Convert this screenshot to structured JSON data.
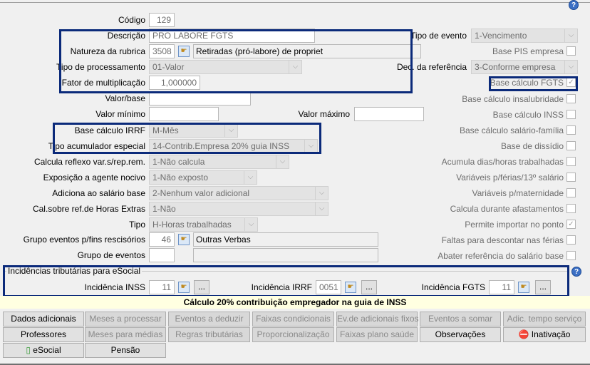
{
  "help_icon": "?",
  "left": {
    "codigo": {
      "label": "Código",
      "value": "129"
    },
    "descricao": {
      "label": "Descrição",
      "value": "PRO LABORE FGTS"
    },
    "natureza": {
      "label": "Natureza da rubrica",
      "code": "3508",
      "description": "Retiradas (pró-labore) de propriet"
    },
    "tipo_processamento": {
      "label": "Tipo de processamento",
      "value": "01-Valor"
    },
    "fator": {
      "label": "Fator de multiplicação",
      "value": "1,000000"
    },
    "valor_base": {
      "label": "Valor/base",
      "value": ""
    },
    "valor_minimo": {
      "label": "Valor mínimo",
      "value": ""
    },
    "valor_maximo": {
      "label": "Valor máximo",
      "value": ""
    },
    "base_irrf": {
      "label": "Base cálculo IRRF",
      "value": "M-Mês"
    },
    "tipo_acumulador": {
      "label": "Tipo acumulador especial",
      "value": "14-Contrib.Empresa 20% guia INSS"
    },
    "calcula_reflexo": {
      "label": "Calcula reflexo var.s/rep.rem.",
      "value": "1-Não calcula"
    },
    "exposicao": {
      "label": "Exposição a agente nocivo",
      "value": "1-Não exposto"
    },
    "adiciona": {
      "label": "Adiciona ao salário base",
      "value": "2-Nenhum valor adicional"
    },
    "cal_sobre": {
      "label": "Cal.sobre ref.de Horas Extras",
      "value": "1-Não"
    },
    "tipo": {
      "label": "Tipo",
      "value": "H-Horas trabalhadas"
    },
    "grupo_rescisorios": {
      "label": "Grupo eventos p/fins rescisórios",
      "code": "46",
      "description": "Outras Verbas"
    },
    "grupo_eventos": {
      "label": "Grupo de eventos",
      "code": "",
      "description": ""
    }
  },
  "right": {
    "tipo_evento": {
      "label": "Tipo de evento",
      "value": "1-Vencimento"
    },
    "dec_referencia": {
      "label": "Dec. da referência",
      "value": "3-Conforme empresa"
    },
    "checks": [
      {
        "label": "Base PIS empresa",
        "checked": false
      },
      {
        "label": "Base cálculo FGTS",
        "checked": true
      },
      {
        "label": "Base cálculo insalubridade",
        "checked": false
      },
      {
        "label": "Base cálculo INSS",
        "checked": false
      },
      {
        "label": "Base cálculo salário-família",
        "checked": false
      },
      {
        "label": "Base de dissídio",
        "checked": false
      },
      {
        "label": "Acumula dias/horas trabalhadas",
        "checked": false
      },
      {
        "label": "Variáveis p/férias/13º salário",
        "checked": false
      },
      {
        "label": "Variáveis p/maternidade",
        "checked": false
      },
      {
        "label": "Calcula durante afastamentos",
        "checked": false
      },
      {
        "label": "Permite importar no ponto",
        "checked": true
      },
      {
        "label": "Faltas para descontar nas férias",
        "checked": false
      },
      {
        "label": "Abater referência do salário base",
        "checked": false
      }
    ]
  },
  "incidencias": {
    "title": "Incidências tributárias para eSocial",
    "inss": {
      "label": "Incidência INSS",
      "value": "11"
    },
    "irrf": {
      "label": "Incidência IRRF",
      "value": "0051"
    },
    "fgts": {
      "label": "Incidência FGTS",
      "value": "11"
    },
    "dots": "..."
  },
  "banner": "Cálculo 20% contribuição empregador na guia de INSS",
  "buttons": [
    [
      {
        "label": "Dados adicionais",
        "enabled": true
      },
      {
        "label": "Meses a processar",
        "enabled": false
      },
      {
        "label": "Eventos a deduzir",
        "enabled": false
      },
      {
        "label": "Faixas condicionais",
        "enabled": false
      },
      {
        "label": "Ev.de adicionais fixos",
        "enabled": false
      },
      {
        "label": "Eventos a somar",
        "enabled": false
      },
      {
        "label": "Adic. tempo serviço",
        "enabled": false
      }
    ],
    [
      {
        "label": "Professores",
        "enabled": true
      },
      {
        "label": "Meses para médias",
        "enabled": false
      },
      {
        "label": "Regras tributárias",
        "enabled": false
      },
      {
        "label": "Proporcionalização",
        "enabled": false
      },
      {
        "label": "Faixas plano saúde",
        "enabled": false
      },
      {
        "label": "Observações",
        "enabled": true
      },
      {
        "label": "Inativação",
        "enabled": true
      }
    ],
    [
      {
        "label": "eSocial",
        "enabled": true
      },
      {
        "label": "Pensão",
        "enabled": true
      }
    ]
  ],
  "colors": {
    "highlight_box": "#0b2a7a",
    "banner_bg": "#ffffe1"
  }
}
